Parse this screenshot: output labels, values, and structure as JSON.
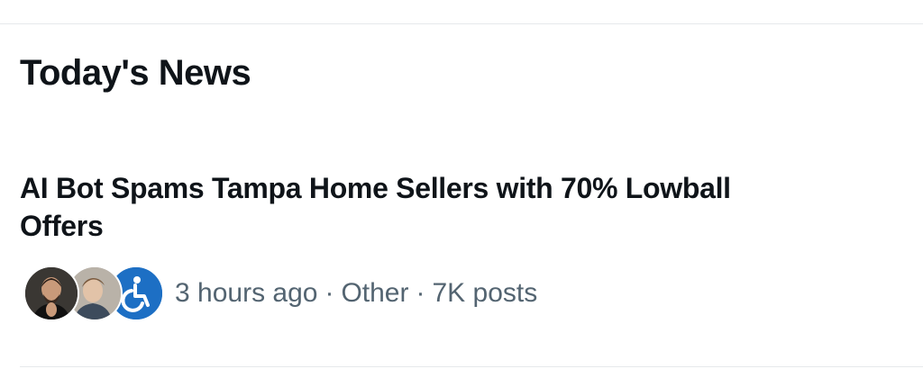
{
  "section": {
    "title": "Today's News"
  },
  "news_item": {
    "headline": "AI Bot Spams Tampa Home Sellers with 70% Lowball Offers",
    "time": "3 hours ago",
    "category": "Other",
    "posts": "7K posts",
    "separator": "·",
    "avatars": [
      "person-avatar",
      "person-avatar",
      "accessibility-icon"
    ],
    "accent_color": "#1d6fc4"
  }
}
